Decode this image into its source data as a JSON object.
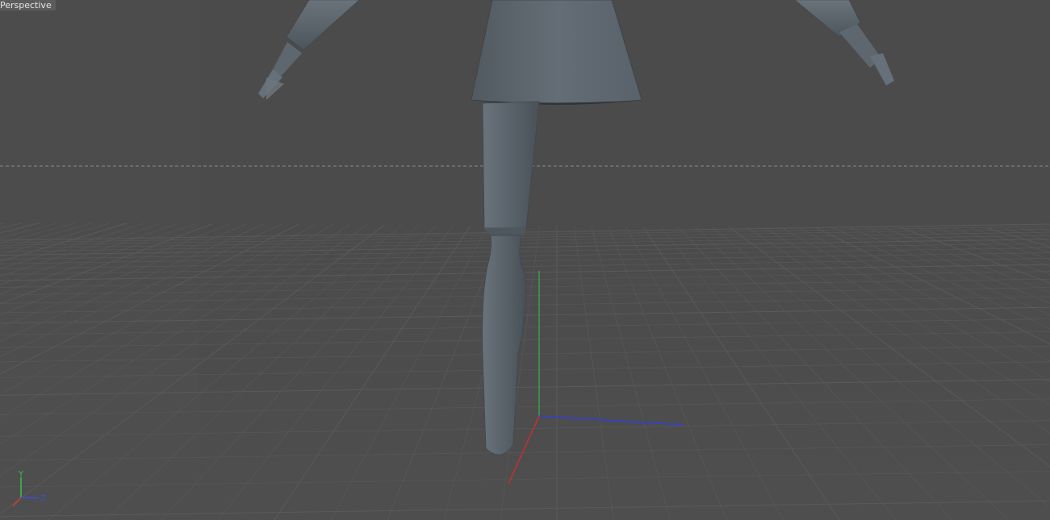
{
  "viewport": {
    "camera_label": "Perspective",
    "background_color": "#4b4b4b",
    "grid_color": "#5a5a5a",
    "model_color": "#5f6870"
  },
  "axis_gizmo": {
    "y_label": "Y",
    "z_label": "Z",
    "y_color": "#39c24a",
    "z_color": "#3a4fd8",
    "x_color": "#d03a3a"
  },
  "origin_axes": {
    "y_color": "#2fb84a",
    "z_color": "#2f3fd8",
    "x_color": "#c63030"
  },
  "model": {
    "name": "character-body",
    "parts": [
      "skirt",
      "left-arm",
      "right-arm",
      "upper-leg",
      "lower-leg"
    ]
  }
}
